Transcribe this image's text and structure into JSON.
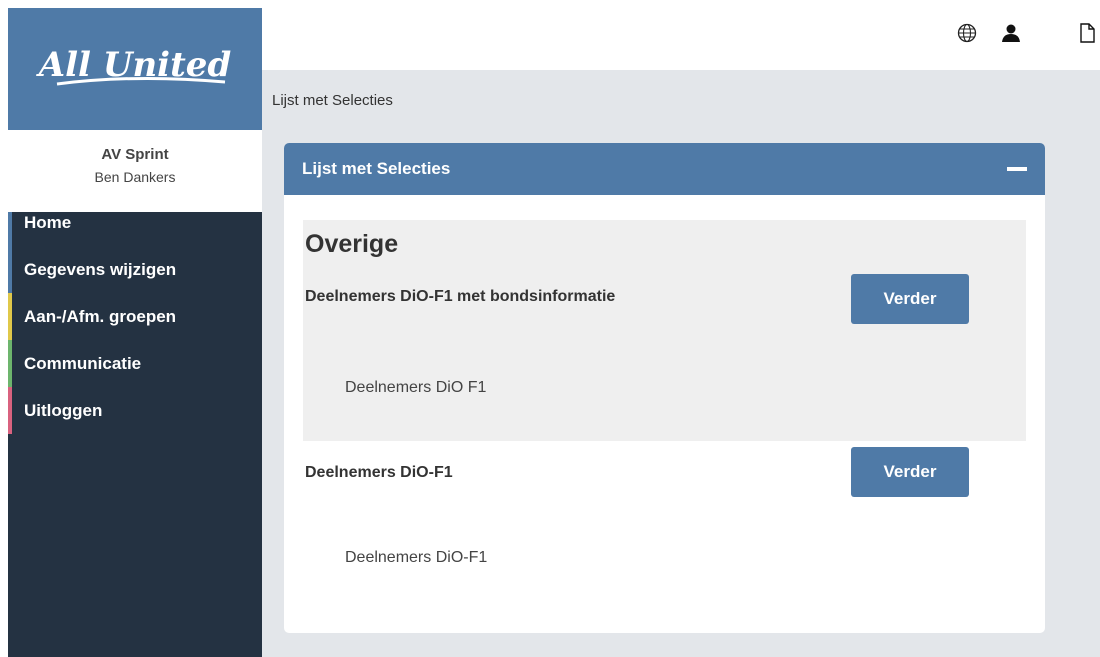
{
  "brand": {
    "logo_text": "All United",
    "colors": {
      "brand_blue": "#4f7aa7",
      "sidebar_dark": "#243242"
    }
  },
  "user": {
    "club": "AV Sprint",
    "name": "Ben Dankers"
  },
  "nav": [
    {
      "label": "Home",
      "accent": "#4f7aa7"
    },
    {
      "label": "Gegevens wijzigen",
      "accent": "#4f7aa7"
    },
    {
      "label": "Aan-/Afm. groepen",
      "accent": "#e0c84a"
    },
    {
      "label": "Communicatie",
      "accent": "#6db56d"
    },
    {
      "label": "Uitloggen",
      "accent": "#d9627f"
    }
  ],
  "topbar": {
    "icons": [
      "globe-icon",
      "user-icon",
      "document-icon"
    ]
  },
  "breadcrumb": "Lijst met Selecties",
  "panel": {
    "title": "Lijst met Selecties",
    "group": {
      "title": "Overige",
      "items": [
        {
          "title": "Deelnemers DiO-F1 met bondsinformatie",
          "description": "Deelnemers DiO F1",
          "button": "Verder"
        }
      ]
    },
    "items": [
      {
        "title": "Deelnemers DiO-F1",
        "description": "Deelnemers DiO-F1",
        "button": "Verder"
      }
    ]
  }
}
